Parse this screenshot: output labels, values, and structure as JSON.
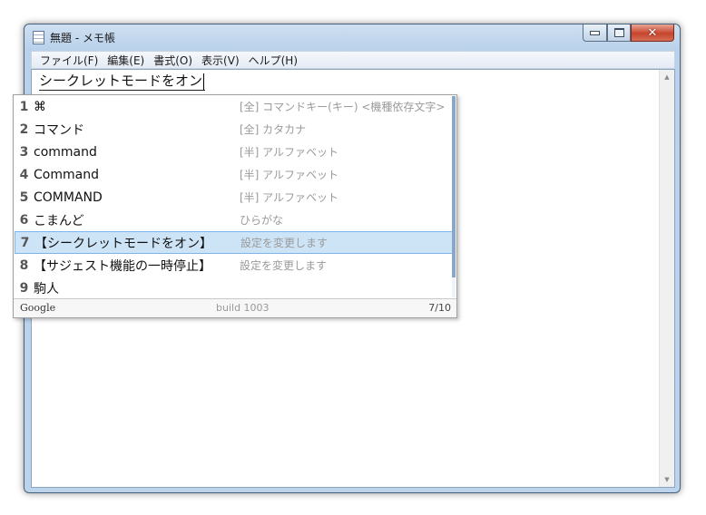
{
  "window": {
    "title": "無題 - メモ帳",
    "close_glyph": "✕"
  },
  "menu": [
    {
      "label": "ファイル(F)"
    },
    {
      "label": "編集(E)"
    },
    {
      "label": "書式(O)"
    },
    {
      "label": "表示(V)"
    },
    {
      "label": "ヘルプ(H)"
    }
  ],
  "editor": {
    "text": "シークレットモードをオン",
    "scroll_up_glyph": "▲",
    "scroll_down_glyph": "▼"
  },
  "candidates": {
    "items": [
      {
        "num": "1",
        "text": "⌘",
        "desc": "[全] コマンドキー(キー) <機種依存文字>"
      },
      {
        "num": "2",
        "text": "コマンド",
        "desc": "[全] カタカナ"
      },
      {
        "num": "3",
        "text": "command",
        "desc": "[半] アルファベット"
      },
      {
        "num": "4",
        "text": "Command",
        "desc": "[半] アルファベット"
      },
      {
        "num": "5",
        "text": "COMMAND",
        "desc": "[半] アルファベット"
      },
      {
        "num": "6",
        "text": "こまんど",
        "desc": "ひらがな"
      },
      {
        "num": "7",
        "text": "【シークレットモードをオン】",
        "desc": "設定を変更します"
      },
      {
        "num": "8",
        "text": "【サジェスト機能の一時停止】",
        "desc": "設定を変更します"
      },
      {
        "num": "9",
        "text": "駒人",
        "desc": ""
      }
    ],
    "selected_index": 6,
    "footer": {
      "brand": "Google",
      "build": "build 1003",
      "page": "7/10"
    }
  },
  "colors": {
    "selection_bg": "#cde4f7",
    "selection_border": "#7eb4ea",
    "close_button": "#c7452d"
  }
}
